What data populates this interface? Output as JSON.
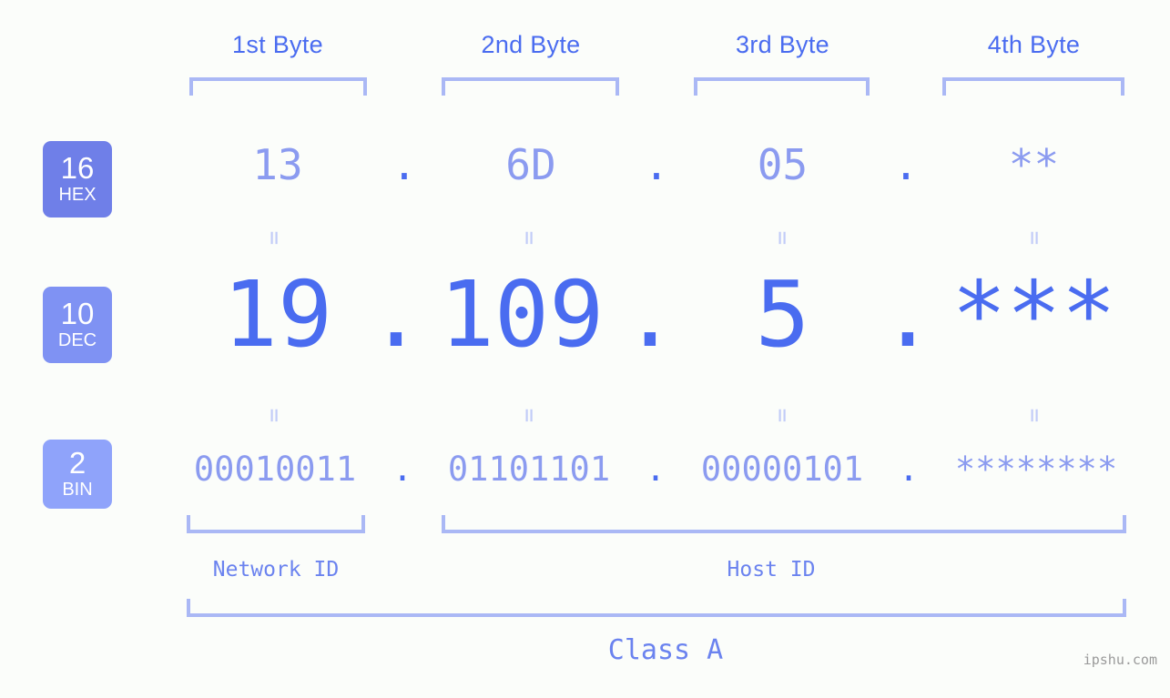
{
  "header": {
    "byte_labels": [
      {
        "label": "1st Byte"
      },
      {
        "label": "2nd Byte"
      },
      {
        "label": "3rd Byte"
      },
      {
        "label": "4th Byte"
      }
    ]
  },
  "bases": [
    {
      "num": "16",
      "abbr": "HEX",
      "color": "#6f7fe8"
    },
    {
      "num": "10",
      "abbr": "DEC",
      "color": "#7f92f3"
    },
    {
      "num": "2",
      "abbr": "BIN",
      "color": "#8fa3fa"
    }
  ],
  "rows": {
    "hex": {
      "values": [
        "13",
        "6D",
        "05",
        "**"
      ],
      "separator": "."
    },
    "dec": {
      "values": [
        "19",
        "109",
        "5",
        "***"
      ],
      "separator": "."
    },
    "bin": {
      "values": [
        "00010011",
        "01101101",
        "00000101",
        "********"
      ],
      "separator": "."
    }
  },
  "separators": {
    "equals": "="
  },
  "footer": {
    "network_id_label": "Network ID",
    "host_id_label": "Host ID",
    "class_label": "Class A",
    "watermark": "ipshu.com"
  },
  "colors": {
    "background": "#fbfdfa",
    "accent_strong": "#4a6cf0",
    "accent_light": "#8b9bf0",
    "bracket": "#aab8f5",
    "equals": "#c2ccf8",
    "label": "#6b83ef",
    "watermark": "#9a9a9a"
  }
}
